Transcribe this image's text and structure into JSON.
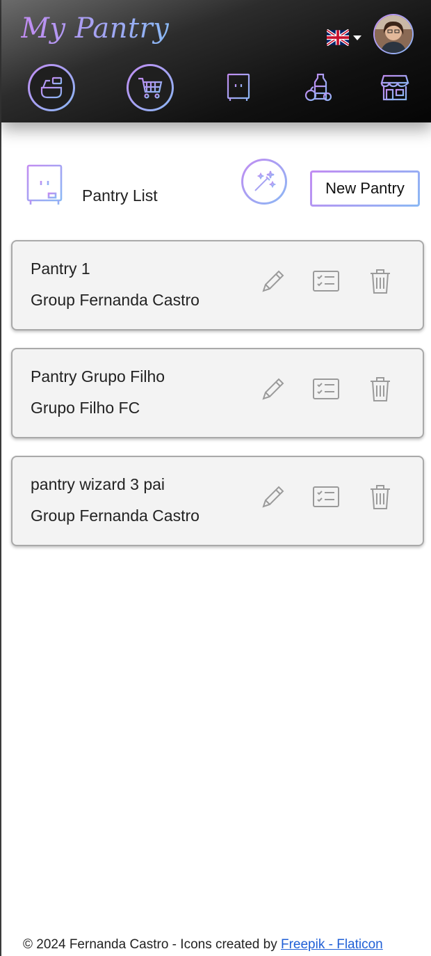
{
  "header": {
    "brand": "My Pantry",
    "language": "English (UK)",
    "nav": [
      {
        "label": "Cooking",
        "icon": "cooking-pot-icon"
      },
      {
        "label": "Shopping",
        "icon": "shopping-cart-icon"
      },
      {
        "label": "Pantry",
        "icon": "cupboard-icon"
      },
      {
        "label": "Products",
        "icon": "groceries-icon"
      },
      {
        "label": "Stores",
        "icon": "store-icon"
      }
    ]
  },
  "toolbar": {
    "title": "Pantry List",
    "new_button": "New Pantry"
  },
  "pantries": [
    {
      "name": "Pantry 1",
      "group": "Group Fernanda Castro"
    },
    {
      "name": "Pantry Grupo Filho",
      "group": "Grupo Filho FC"
    },
    {
      "name": "pantry wizard 3 pai",
      "group": "Group Fernanda Castro"
    }
  ],
  "footer": {
    "text": "© 2024 Fernanda Castro - Icons created by ",
    "link": "Freepik - Flaticon"
  },
  "colors": {
    "accent_purple": "#c28cf2",
    "accent_blue": "#8ab8f4",
    "header_dark": "#111111",
    "card_bg": "#f3f3f3",
    "action_icon": "#9a9a9a",
    "link": "#1f5fd6"
  }
}
